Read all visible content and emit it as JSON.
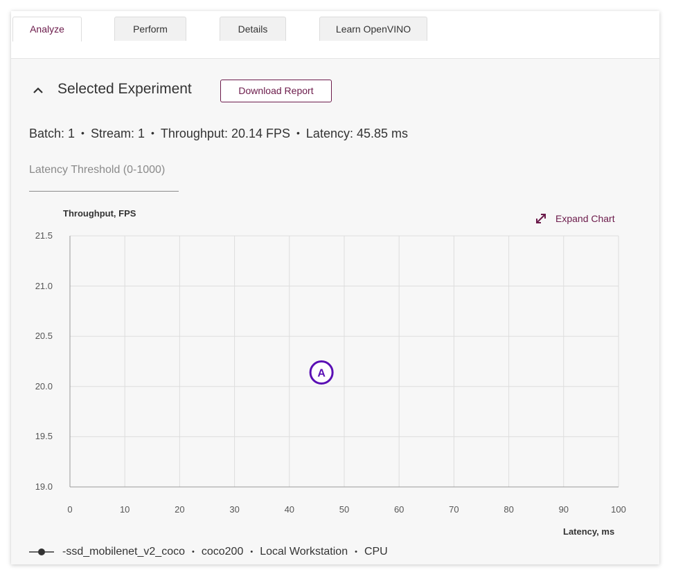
{
  "tabs": [
    {
      "label": "Analyze",
      "active": true
    },
    {
      "label": "Perform",
      "active": false
    },
    {
      "label": "Details",
      "active": false
    },
    {
      "label": "Learn OpenVINO",
      "active": false
    }
  ],
  "section": {
    "title": "Selected Experiment",
    "toggle_icon": "chevron-up-icon",
    "download_label": "Download Report"
  },
  "stats": {
    "batch": "Batch: 1",
    "stream": "Stream: 1",
    "throughput": "Throughput: 20.14 FPS",
    "latency": "Latency: 45.85 ms",
    "separator": "•"
  },
  "threshold": {
    "placeholder": "Latency Threshold (0-1000)",
    "value": ""
  },
  "expand_chart": {
    "label": "Expand Chart",
    "icon": "expand-arrows-icon"
  },
  "chart_data": {
    "type": "scatter",
    "xlabel": "Latency, ms",
    "ylabel": "Throughput, FPS",
    "xlim": [
      0,
      100
    ],
    "ylim": [
      19.0,
      21.5
    ],
    "x_ticks": [
      "0",
      "10",
      "20",
      "30",
      "40",
      "50",
      "60",
      "70",
      "80",
      "90",
      "100"
    ],
    "y_ticks": [
      "21.5",
      "21.0",
      "20.5",
      "20.0",
      "19.5",
      "19.0"
    ],
    "grid": true,
    "points": [
      {
        "label": "A",
        "x": 45.85,
        "y": 20.14
      }
    ],
    "point_color": "#5a0fb4"
  },
  "legend": {
    "prefix": "- ",
    "model": "ssd_mobilenet_v2_coco",
    "dataset": "coco200",
    "target": "Local Workstation",
    "device": "CPU",
    "separator": "•"
  },
  "colors": {
    "accent": "#6b1a4a",
    "point": "#5a0fb4"
  }
}
